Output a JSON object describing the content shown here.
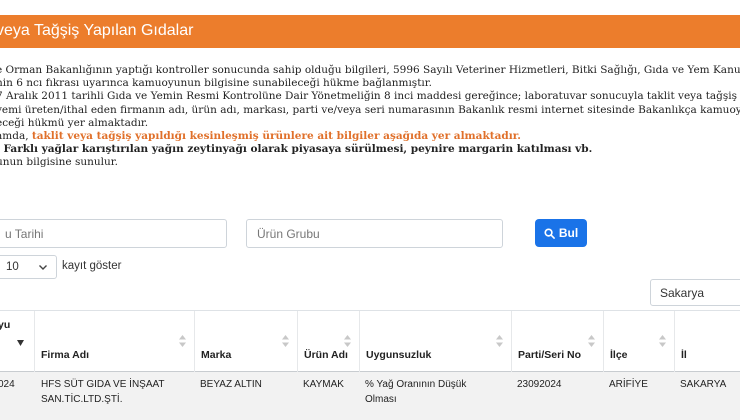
{
  "banner": {
    "title": "veya Tağşiş Yapılan Gıdalar"
  },
  "intro": {
    "line1": "e Orman Bakanlığının yaptığı kontroller sonucunda sahip olduğu bilgileri, 5996 Sayılı Veteriner Hizmetleri, Bitki Sağlığı, Gıda ve Yem Kanunu",
    "line2": "nin 6 ncı fıkrası uyarınca kamuoyunun bilgisine sunabileceği hükme bağlanmıştır.",
    "line3": "7 Aralık 2011 tarihli Gıda ve Yemin Resmi Kontrolüne Dair Yönetmeliğin 8 inci maddesi gereğince; laboratuvar sonucuyla taklit veya tağşiş yapıldı",
    "line4": "yemi üreten/ithal eden firmanın adı, ürün adı, markası, parti ve/veya seri numarasının Bakanlık resmi internet sitesinde Bakanlıkça kamuoyu",
    "line5": "eceği hükmü yer almaktadır.",
    "line6_prefix": "amda, ",
    "line6_highlight": "taklit veya tağşiş yapıldığı kesinleşmiş ürünlere ait bilgiler aşağıda yer almaktadır.",
    "line7": ": Farklı yağlar karıştırılan yağın zeytinyağı olarak piyasaya sürülmesi, peynire margarin katılması vb.",
    "line8": "unun bilgisine sunulur."
  },
  "filters": {
    "date_placeholder": "u Tarihi",
    "group_placeholder": "Ürün Grubu",
    "search_label": "Bul"
  },
  "page_length": {
    "value": "10",
    "label": "kayıt göster"
  },
  "city_filter": {
    "value": "Sakarya"
  },
  "table": {
    "headers": {
      "date_line1": "yu",
      "firm": "Firma Adı",
      "brand": "Marka",
      "product": "Ürün Adı",
      "nonconformity": "Uygunsuzluk",
      "lot": "Parti/Seri No",
      "district": "İlçe",
      "province": "İl"
    },
    "rows": [
      {
        "date": "024",
        "firm": "HFS SÜT GIDA VE İNŞAAT SAN.TİC.LTD.ŞTİ.",
        "brand": "BEYAZ ALTIN",
        "product": "KAYMAK",
        "nonconformity": "% Yağ Oranının Düşük Olması",
        "lot": "23092024",
        "district": "ARİFİYE",
        "province": "SAKARYA"
      }
    ]
  },
  "colors": {
    "banner": "#ec7d2c",
    "highlight": "#e0702a",
    "button": "#1a73e8",
    "row_shade": "#f2f2f2"
  },
  "icons": {
    "search": "search-icon",
    "dropdown": "chevron-down-icon",
    "sort": "sort-icon"
  }
}
